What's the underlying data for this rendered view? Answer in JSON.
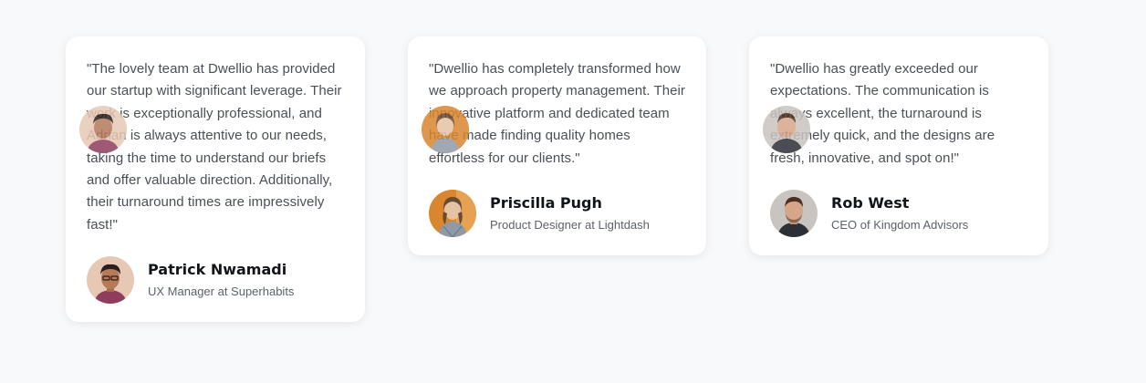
{
  "testimonials": [
    {
      "quote": "\"The lovely team at Dwellio has provided our startup with significant leverage. Their work is exceptionally professional, and Adrian is always attentive to our needs, taking the time to understand our briefs and offer valuable direction. Additionally, their turnaround times are impressively fast!\"",
      "name": "Patrick Nwamadi",
      "role": "UX Manager at Superhabits",
      "avatar_icon": "person-avatar-icon",
      "avatar_colors": {
        "bg": "#e7c8b4",
        "skin": "#b57a5a",
        "hair": "#2a1f1c",
        "shirt": "#8e3d5c"
      }
    },
    {
      "quote": "\"Dwellio has completely transformed how we approach property management. Their innovative platform and dedicated team have made finding quality homes effortless for our clients.\"",
      "name": "Priscilla Pugh",
      "role": "Product Designer at Lightdash",
      "avatar_icon": "person-avatar-icon",
      "avatar_colors": {
        "bg": "#d9862e",
        "skin": "#e6c2a4",
        "hair": "#6b4a32",
        "shirt": "#8f9aa6"
      }
    },
    {
      "quote": "\"Dwellio has greatly exceeded our expectations. The communication is always excellent, the turnaround is extremely quick, and the designs are fresh, innovative, and spot on!\"",
      "name": "Rob West",
      "role": "CEO of Kingdom Advisors",
      "avatar_icon": "person-avatar-icon",
      "avatar_colors": {
        "bg": "#c9c4bf",
        "skin": "#d6a58a",
        "hair": "#4a3022",
        "shirt": "#2b2f36"
      }
    }
  ]
}
